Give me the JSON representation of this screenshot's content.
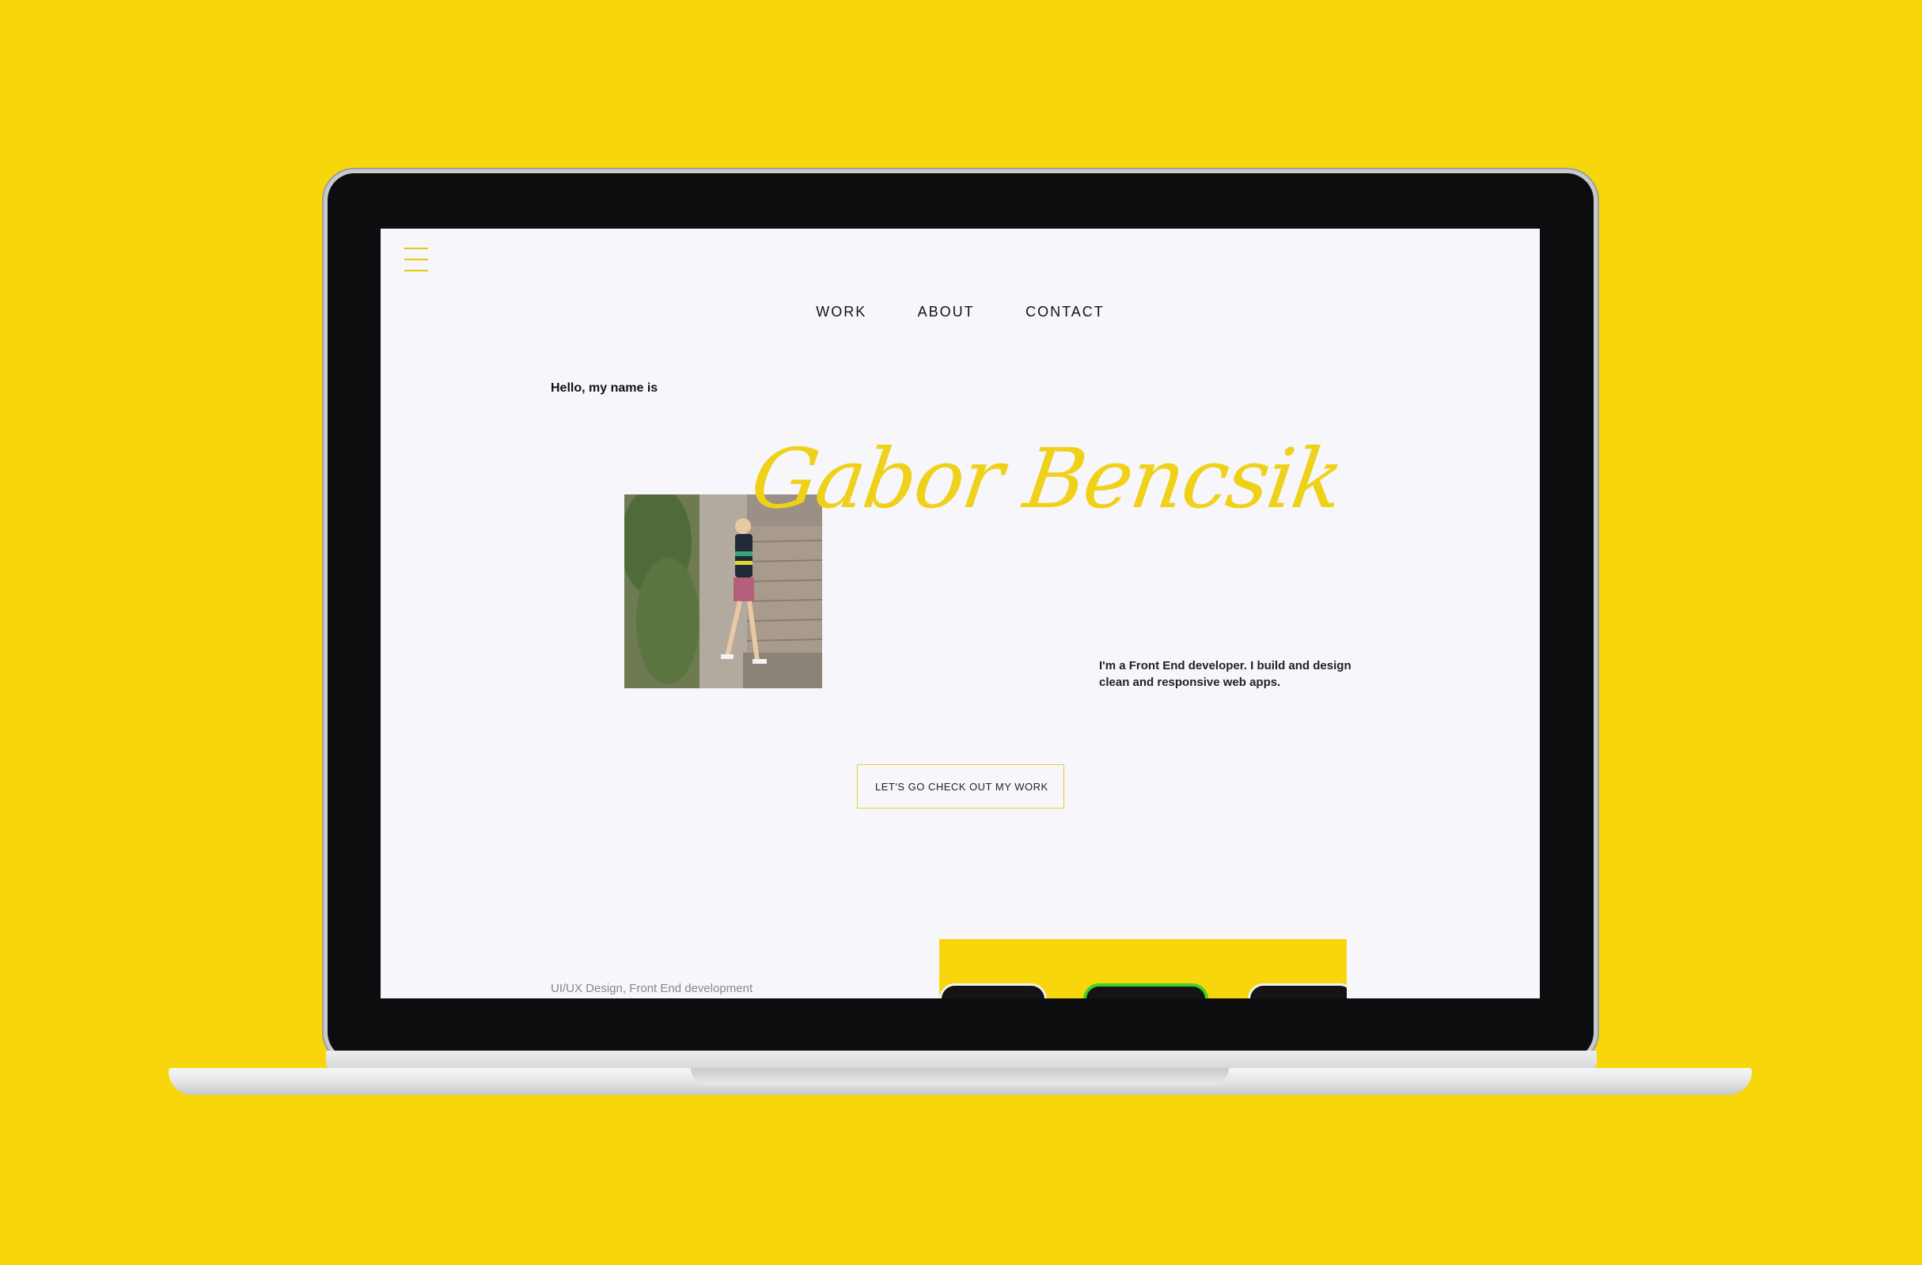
{
  "colors": {
    "background": "#f7d70c",
    "accent": "#f0d11a",
    "screen_bg": "#f7f7fb"
  },
  "header": {
    "menu_icon": "hamburger-menu-icon",
    "nav": [
      {
        "label": "WORK"
      },
      {
        "label": "ABOUT"
      },
      {
        "label": "CONTACT"
      }
    ]
  },
  "hero": {
    "greeting": "Hello, my name is",
    "name": "Gabor Bencsik",
    "intro": "I'm a Front End developer. I build and design clean and responsive web apps.",
    "cta_label": "LET'S GO CHECK OUT MY WORK"
  },
  "work_preview": {
    "tagline": "UI/UX Design, Front End development"
  }
}
